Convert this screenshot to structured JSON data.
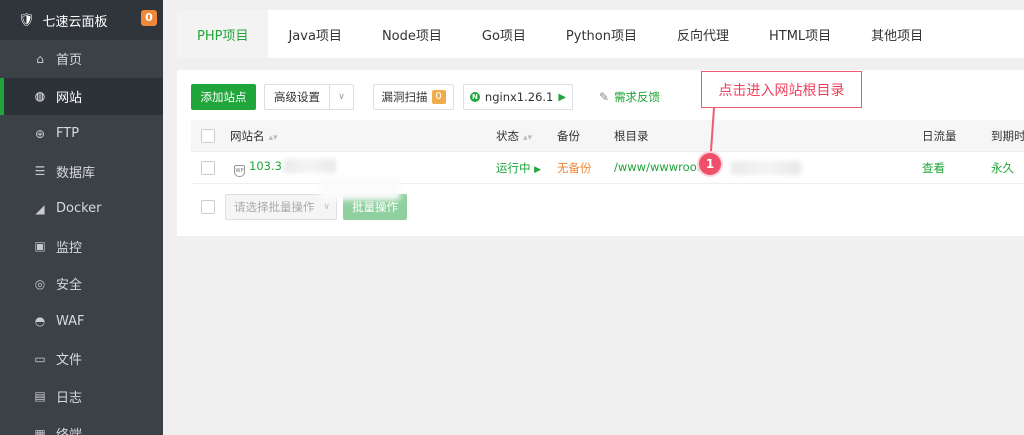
{
  "sidebar": {
    "brand": "七速云面板",
    "badge": "0",
    "items": [
      {
        "label": "首页",
        "icon": "home-icon",
        "glyph": "⌂"
      },
      {
        "label": "网站",
        "icon": "globe-icon",
        "glyph": "◍"
      },
      {
        "label": "FTP",
        "icon": "ftp-icon",
        "glyph": "⊕"
      },
      {
        "label": "数据库",
        "icon": "database-icon",
        "glyph": "☰"
      },
      {
        "label": "Docker",
        "icon": "docker-icon",
        "glyph": "◢"
      },
      {
        "label": "监控",
        "icon": "monitor-icon",
        "glyph": "▣"
      },
      {
        "label": "安全",
        "icon": "shield-icon",
        "glyph": "◎"
      },
      {
        "label": "WAF",
        "icon": "waf-icon",
        "glyph": "◓"
      },
      {
        "label": "文件",
        "icon": "folder-icon",
        "glyph": "▭"
      },
      {
        "label": "日志",
        "icon": "log-icon",
        "glyph": "▤"
      },
      {
        "label": "终端",
        "icon": "terminal-icon",
        "glyph": "▦"
      }
    ],
    "active_index": 1
  },
  "tabs": [
    {
      "label": "PHP项目",
      "active": true
    },
    {
      "label": "Java项目"
    },
    {
      "label": "Node项目"
    },
    {
      "label": "Go项目"
    },
    {
      "label": "Python项目"
    },
    {
      "label": "反向代理"
    },
    {
      "label": "HTML项目"
    },
    {
      "label": "其他项目"
    }
  ],
  "toolbar": {
    "add_site": "添加站点",
    "advanced": "高级设置",
    "vuln_scan": "漏洞扫描",
    "vuln_count": "0",
    "nginx": "nginx1.26.1",
    "feedback": "需求反馈"
  },
  "table": {
    "headers": {
      "site_name": "网站名",
      "status": "状态",
      "backup": "备份",
      "root": "根目录",
      "traffic": "日流量",
      "expire": "到期时"
    },
    "rows": [
      {
        "site_name": "103.3",
        "status": "运行中",
        "backup": "无备份",
        "root": "/www/wwwroot/",
        "traffic": "查看",
        "expire": "永久"
      }
    ]
  },
  "batch": {
    "placeholder": "请选择批量操作",
    "button": "批量操作"
  },
  "annotation": {
    "text": "点击进入网站根目录",
    "marker": "1"
  },
  "colors": {
    "accent": "#20a53a",
    "sidebar_bg": "#3b4147",
    "annotation": "#ef5a6f",
    "badge": "#f0883a"
  }
}
